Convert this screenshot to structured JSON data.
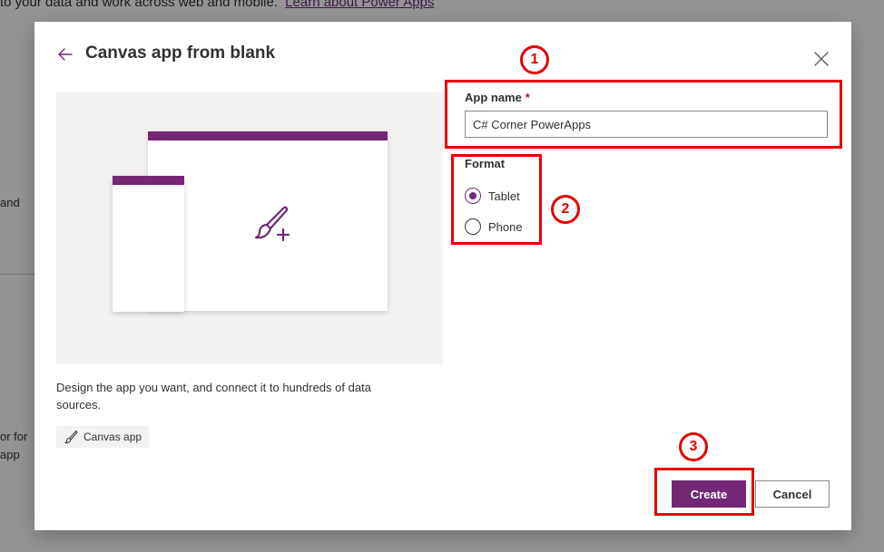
{
  "background": {
    "top_text": "to your data and work across web and mobile.",
    "top_link": "Learn about Power Apps",
    "fragment_1": "and",
    "fragment_2": "or for",
    "fragment_3": "app"
  },
  "dialog": {
    "title": "Canvas app from blank",
    "description": "Design the app you want, and connect it to hundreds of data sources.",
    "tag_label": "Canvas app",
    "app_name": {
      "label": "App name",
      "required_mark": "*",
      "value": "C# Corner PowerApps"
    },
    "format": {
      "label": "Format",
      "options": [
        "Tablet",
        "Phone"
      ],
      "selected": "Tablet"
    },
    "buttons": {
      "create": "Create",
      "cancel": "Cancel"
    }
  },
  "annotations": {
    "badges": [
      "1",
      "2",
      "3"
    ],
    "color": "#e60000"
  },
  "colors": {
    "accent": "#742774",
    "overlay": "rgba(0,0,0,0.42)"
  },
  "icons": [
    "back-arrow-icon",
    "close-icon",
    "paintbrush-plus-icon",
    "paintbrush-icon"
  ]
}
